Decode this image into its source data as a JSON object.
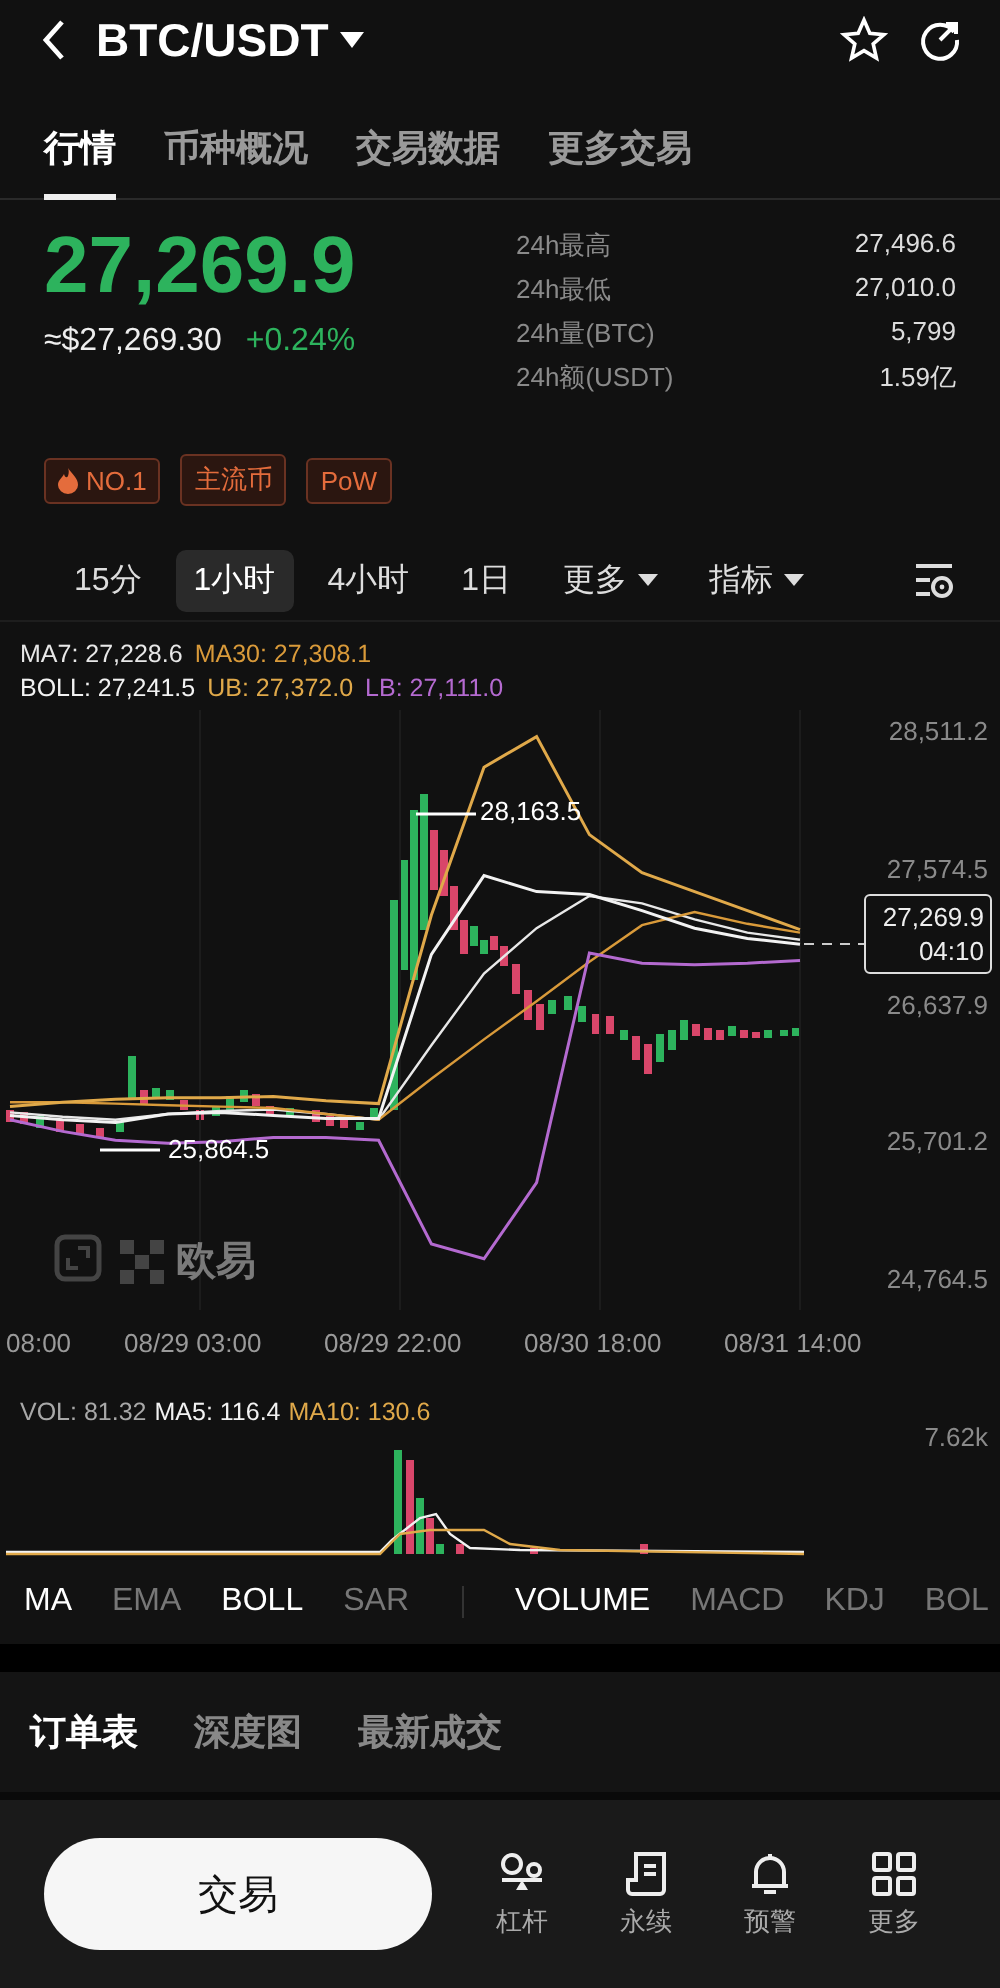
{
  "header": {
    "title": "BTC/USDT"
  },
  "tabs": [
    {
      "label": "行情",
      "selected": true
    },
    {
      "label": "币种概况",
      "selected": false
    },
    {
      "label": "交易数据",
      "selected": false
    },
    {
      "label": "更多交易",
      "selected": false
    }
  ],
  "ticker": {
    "price": "27,269.9",
    "fiat": "≈$27,269.30",
    "change": "+0.24%",
    "rising": true
  },
  "stats": [
    {
      "label": "24h最高",
      "value": "27,496.6"
    },
    {
      "label": "24h最低",
      "value": "27,010.0"
    },
    {
      "label": "24h量(BTC)",
      "value": "5,799"
    },
    {
      "label": "24h额(USDT)",
      "value": "1.59亿"
    }
  ],
  "tags": [
    {
      "label": "NO.1",
      "kind": "hot"
    },
    {
      "label": "主流币",
      "kind": "plain"
    },
    {
      "label": "PoW",
      "kind": "plain"
    }
  ],
  "intervals": [
    {
      "label": "15分",
      "selected": false,
      "kind": "option"
    },
    {
      "label": "1小时",
      "selected": true,
      "kind": "option"
    },
    {
      "label": "4小时",
      "selected": false,
      "kind": "option"
    },
    {
      "label": "1日",
      "selected": false,
      "kind": "option"
    },
    {
      "label": "更多",
      "selected": false,
      "kind": "menu"
    },
    {
      "label": "指标",
      "selected": false,
      "kind": "menu"
    }
  ],
  "chart": {
    "legend_values": [
      ": 27,228.6",
      ": 27,308.1",
      ": 27,241.5",
      ": 27,372.0",
      ": 27,111.0"
    ],
    "time_ticks": [
      "08:00",
      "08/29 03:00",
      "08/29 22:00",
      "08/30 18:00",
      "08/31 14:00"
    ],
    "high_label": "28,163.5",
    "low_label": "25,864.5",
    "last_price": "27,269.9",
    "countdown": "04:10",
    "logo": "欧易",
    "chart_data": {
      "type": "line",
      "series": [
        {
          "name": "MA7",
          "color": "#e8e8e8",
          "values": [
            25910,
            25880,
            25860,
            25900,
            25920,
            25930,
            25900,
            25860,
            26370,
            26860,
            27170,
            27390,
            27340,
            27230,
            27140,
            27090
          ]
        },
        {
          "name": "MA30",
          "color": "#d99a3a",
          "values": [
            25980,
            25980,
            25970,
            25960,
            25950,
            25940,
            25900,
            25860,
            26140,
            26410,
            26670,
            26940,
            27190,
            27280,
            27200,
            27140
          ]
        },
        {
          "name": "BOLL",
          "color": "#f2f2f2",
          "values": [
            25890,
            25860,
            25840,
            25900,
            25910,
            25890,
            25870,
            25870,
            26990,
            27530,
            27420,
            27400,
            27290,
            27170,
            27100,
            27060
          ]
        },
        {
          "name": "UB",
          "color": "#e0a94a",
          "values": [
            25950,
            25980,
            26000,
            26010,
            26010,
            26020,
            25990,
            25970,
            27260,
            28270,
            28480,
            27810,
            27550,
            27420,
            27290,
            27160
          ]
        },
        {
          "name": "LB",
          "color": "#b46ad0",
          "values": [
            25860,
            25780,
            25720,
            25700,
            25710,
            25740,
            25740,
            25720,
            25010,
            24910,
            25430,
            27000,
            26930,
            26920,
            26930,
            26950
          ]
        }
      ],
      "ylim": [
        24559.4,
        28661.6
      ],
      "yticks": [
        {
          "value": 28511.2,
          "label": "28,511.2"
        },
        {
          "value": 27574.5,
          "label": "27,574.5"
        },
        {
          "value": 26637.9,
          "label": "26,637.9"
        },
        {
          "value": 25701.2,
          "label": "25,701.2"
        },
        {
          "value": 24764.5,
          "label": "24,764.5"
        }
      ]
    }
  },
  "volume": {
    "legend": [
      {
        "text": "VOL: 81.32",
        "color": "#a8a8a8"
      },
      {
        "text": "MA5: 116.4",
        "color": "#f2f2f2"
      },
      {
        "text": "MA10: 130.6",
        "color": "#e0a94a"
      }
    ],
    "max_tick": "7.62k"
  },
  "indicators": [
    {
      "label": "MA",
      "selected": true,
      "separated": false
    },
    {
      "label": "EMA",
      "selected": false,
      "separated": false
    },
    {
      "label": "BOLL",
      "selected": true,
      "separated": false
    },
    {
      "label": "SAR",
      "selected": false,
      "separated": false
    },
    {
      "label": "VOLUME",
      "selected": true,
      "separated": true
    },
    {
      "label": "MACD",
      "selected": false,
      "separated": false
    },
    {
      "label": "KDJ",
      "selected": false,
      "separated": false
    },
    {
      "label": "BOL",
      "selected": false,
      "separated": false
    }
  ],
  "order_tabs": [
    {
      "label": "订单表",
      "selected": true
    },
    {
      "label": "深度图",
      "selected": false
    },
    {
      "label": "最新成交",
      "selected": false
    }
  ],
  "bottom": {
    "trade_button": "交易",
    "actions": [
      {
        "label": "杠杆",
        "kind": "leverage"
      },
      {
        "label": "永续",
        "kind": "perpetual"
      },
      {
        "label": "预警",
        "kind": "alert"
      },
      {
        "label": "更多",
        "kind": "more"
      }
    ]
  }
}
